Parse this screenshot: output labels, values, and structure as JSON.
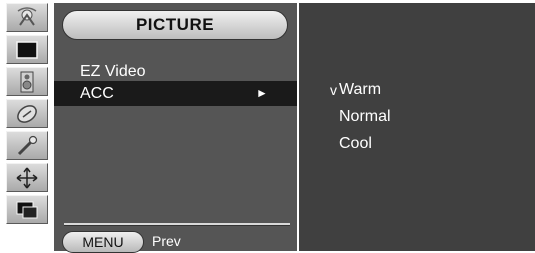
{
  "menu": {
    "title": "PICTURE",
    "items": [
      {
        "label": "EZ Video"
      },
      {
        "label": "ACC",
        "arrow": "►"
      }
    ],
    "footer": {
      "key_label": "MENU",
      "action_label": "Prev"
    }
  },
  "options": [
    {
      "label": "Warm",
      "check": "v"
    },
    {
      "label": "Normal"
    },
    {
      "label": "Cool"
    }
  ],
  "icons": [
    "station-icon",
    "screen-icon",
    "speaker-icon",
    "time-icon",
    "wrench-icon",
    "position-icon",
    "pip-icon"
  ]
}
